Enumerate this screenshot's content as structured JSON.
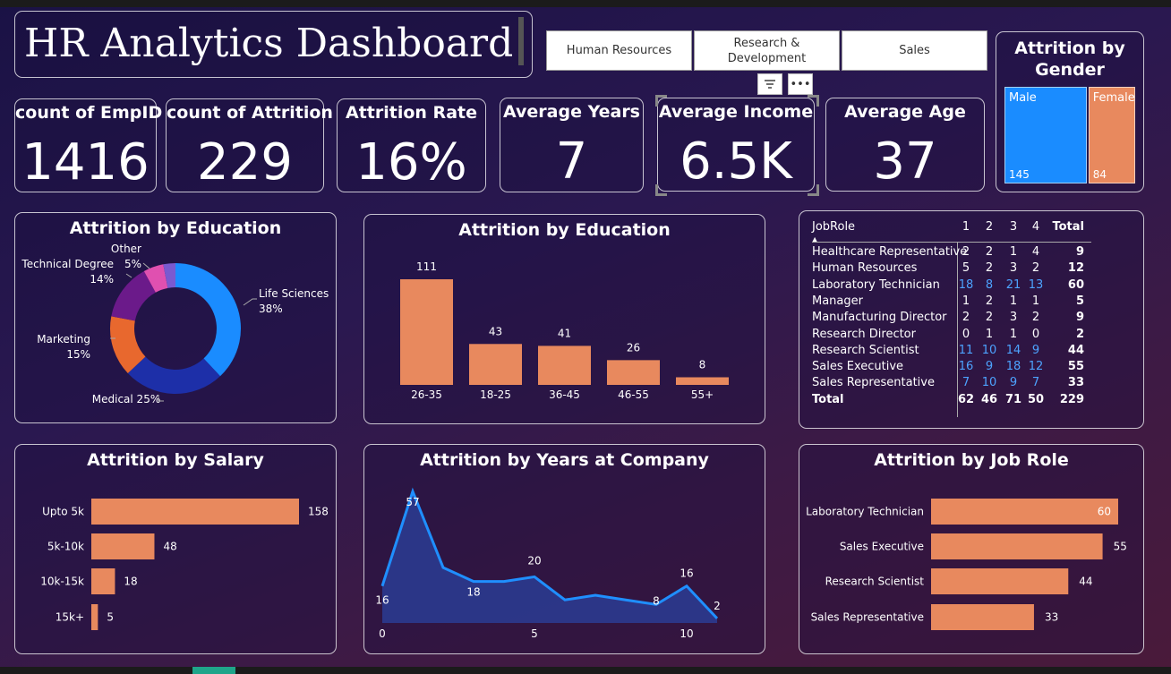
{
  "title": "HR Analytics Dashboard",
  "slicers": [
    "Human Resources",
    "Research & Development",
    "Sales"
  ],
  "kpis": [
    {
      "label": "count of EmpID",
      "value": "1416"
    },
    {
      "label": "count of Attrition",
      "value": "229"
    },
    {
      "label": "Attrition Rate",
      "value": "16%"
    },
    {
      "label": "Average Years",
      "value": "7"
    },
    {
      "label": "Average Income",
      "value": "6.5K"
    },
    {
      "label": "Average Age",
      "value": "37"
    }
  ],
  "colors": {
    "accent": "#e8895e",
    "blue": "#1a8cff",
    "navy": "#2b3a9f",
    "line": "#1f8fff"
  },
  "chart_data": [
    {
      "type": "treemap",
      "title": "Attrition by Gender",
      "categories": [
        "Male",
        "Female"
      ],
      "values": [
        145,
        84
      ],
      "colors": [
        "#1a8cff",
        "#e8895e"
      ]
    },
    {
      "type": "pie",
      "title": "Attrition by Education",
      "categories": [
        "Life Sciences",
        "Medical",
        "Marketing",
        "Technical Degree",
        "Other"
      ],
      "values": [
        38,
        25,
        15,
        14,
        5
      ],
      "labels": [
        "Life Sciences\n38%",
        "Medical 25%",
        "Marketing\n15%",
        "Technical Degree\n14%",
        "Other\n5%"
      ],
      "colors": [
        "#1a8cff",
        "#1d2fa8",
        "#e8682e",
        "#6b1a8a",
        "#e050b0",
        "#7a5ad0"
      ]
    },
    {
      "type": "bar",
      "title": "Attrition by Education",
      "categories": [
        "26-35",
        "18-25",
        "36-45",
        "46-55",
        "55+"
      ],
      "values": [
        111,
        43,
        41,
        26,
        8
      ]
    },
    {
      "type": "table",
      "columns": [
        "JobRole",
        "1",
        "2",
        "3",
        "4",
        "Total"
      ],
      "rows": [
        [
          "Healthcare Representative",
          "2",
          "2",
          "1",
          "4",
          "9"
        ],
        [
          "Human Resources",
          "5",
          "2",
          "3",
          "2",
          "12"
        ],
        [
          "Laboratory Technician",
          "18",
          "8",
          "21",
          "13",
          "60"
        ],
        [
          "Manager",
          "1",
          "2",
          "1",
          "1",
          "5"
        ],
        [
          "Manufacturing Director",
          "2",
          "2",
          "3",
          "2",
          "9"
        ],
        [
          "Research Director",
          "0",
          "1",
          "1",
          "0",
          "2"
        ],
        [
          "Research Scientist",
          "11",
          "10",
          "14",
          "9",
          "44"
        ],
        [
          "Sales Executive",
          "16",
          "9",
          "18",
          "12",
          "55"
        ],
        [
          "Sales Representative",
          "7",
          "10",
          "9",
          "7",
          "33"
        ]
      ],
      "highlight_rows": [
        2,
        6,
        7,
        8
      ],
      "total": [
        "Total",
        "62",
        "46",
        "71",
        "50",
        "229"
      ]
    },
    {
      "type": "bar",
      "orientation": "horizontal",
      "title": "Attrition by Salary",
      "categories": [
        "Upto 5k",
        "5k-10k",
        "10k-15k",
        "15k+"
      ],
      "values": [
        158,
        48,
        18,
        5
      ]
    },
    {
      "type": "area",
      "title": "Attrition by Years at Company",
      "x": [
        0,
        1,
        2,
        3,
        4,
        5,
        6,
        7,
        8,
        9,
        10,
        11
      ],
      "values": [
        16,
        57,
        24,
        18,
        18,
        20,
        10,
        12,
        10,
        8,
        16,
        2
      ],
      "labeled_indices": [
        0,
        1,
        3,
        5,
        9,
        10,
        11
      ],
      "xticks": [
        0,
        5,
        10
      ]
    },
    {
      "type": "bar",
      "orientation": "horizontal",
      "title": "Attrition by Job Role",
      "categories": [
        "Laboratory Technician",
        "Sales Executive",
        "Research Scientist",
        "Sales Representative"
      ],
      "values": [
        60,
        55,
        44,
        33
      ]
    }
  ]
}
